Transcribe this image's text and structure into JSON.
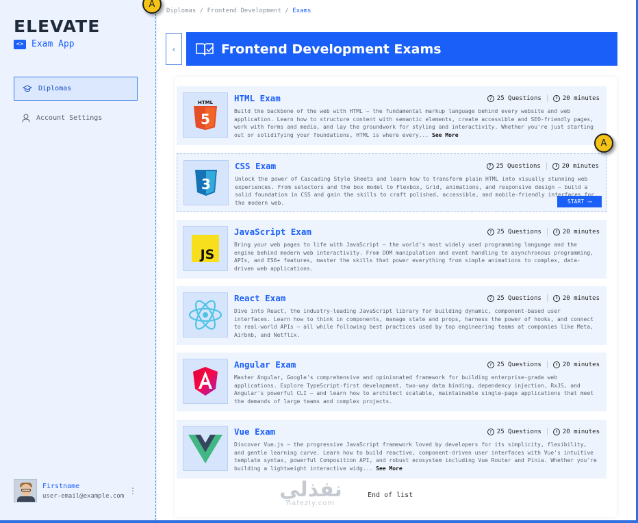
{
  "sidebar": {
    "logo": "ELEVATE",
    "app_name": "Exam App",
    "nav": [
      {
        "label": "Diplomas",
        "icon": "graduation-cap-icon",
        "active": true
      },
      {
        "label": "Account Settings",
        "icon": "user-icon",
        "active": false
      }
    ],
    "user": {
      "name": "Firstname",
      "email": "user-email@example.com"
    }
  },
  "breadcrumb": [
    "Diplomas",
    "Frontend Development",
    "Exams"
  ],
  "header": {
    "title": "Frontend Development Exams",
    "icon": "book-check-icon"
  },
  "exams": [
    {
      "title": "HTML Exam",
      "questions": "25 Questions",
      "duration": "20 minutes",
      "icon": "html5-icon",
      "description": "Build the backbone of the web with HTML – the fundamental markup language behind every website and web application. Learn how to structure content with semantic elements, create accessible and SEO-friendly pages, work with forms and media, and lay the groundwork for styling and interactivity. Whether you're just starting out or solidifying your foundations, HTML is where every...",
      "see_more": "See More"
    },
    {
      "title": "CSS Exam",
      "questions": "25 Questions",
      "duration": "20 minutes",
      "icon": "css3-icon",
      "description": "Unlock the power of Cascading Style Sheets and learn how to transform plain HTML into visually stunning web experiences. From selectors and the box model to Flexbox, Grid, animations, and responsive design – build a solid foundation in CSS and gain the skills to craft polished, accessible, and mobile-friendly interfaces for the modern web.",
      "start_label": "START"
    },
    {
      "title": "JavaScript Exam",
      "questions": "25 Questions",
      "duration": "20 minutes",
      "icon": "javascript-icon",
      "description": "Bring your web pages to life with JavaScript – the world's most widely used programming language and the engine behind modern web interactivity. From DOM manipulation and event handling to asynchronous programming, APIs, and ES6+ features, master the skills that power everything from simple animations to complex, data-driven web applications."
    },
    {
      "title": "React Exam",
      "questions": "25 Questions",
      "duration": "20 minutes",
      "icon": "react-icon",
      "description": "Dive into React, the industry-leading JavaScript library for building dynamic, component-based user interfaces. Learn how to think in components, manage state and props, harness the power of hooks, and connect to real-world APIs – all while following best practices used by top engineering teams at companies like Meta, Airbnb, and Netflix."
    },
    {
      "title": "Angular Exam",
      "questions": "25 Questions",
      "duration": "20 minutes",
      "icon": "angular-icon",
      "description": "Master Angular, Google's comprehensive and opinionated framework for building enterprise-grade web applications. Explore TypeScript-first development, two-way data binding, dependency injection, RxJS, and Angular's powerful CLI – and learn how to architect scalable, maintainable single-page applications that meet the demands of large teams and complex projects."
    },
    {
      "title": "Vue Exam",
      "questions": "25 Questions",
      "duration": "20 minutes",
      "icon": "vue-icon",
      "description": "Discover Vue.js – the progressive JavaScript framework loved by developers for its simplicity, flexibility, and gentle learning curve. Learn how to build reactive, component-driven user interfaces with Vue's intuitive template syntax, powerful Composition API, and robust ecosystem including Vue Router and Pinia. Whether you're building a lightweight interactive widg...",
      "see_more": "See More"
    }
  ],
  "end_of_list": "End of list",
  "watermark": {
    "arabic": "نفذلي",
    "latin": "nafezly.com"
  },
  "cursors": [
    "A",
    "A"
  ],
  "colors": {
    "primary": "#1a5ff7",
    "sidebar_bg": "#ecf3ff",
    "card_bg": "#eef4fe"
  }
}
